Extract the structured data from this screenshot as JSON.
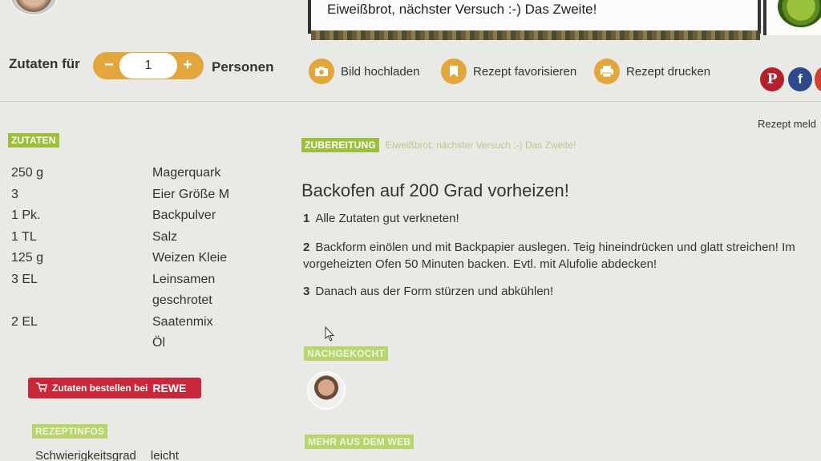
{
  "header": {
    "recipe_title": "Eiweißbrot, nächster Versuch :-) Das Zweite!"
  },
  "servings": {
    "label_before": "Zutaten für",
    "minus": "−",
    "value": "1",
    "plus": "+",
    "label_after": "Personen"
  },
  "actions": {
    "upload": "Bild hochladen",
    "favorite": "Rezept favorisieren",
    "print": "Rezept drucken"
  },
  "social": {
    "pinterest": "P",
    "facebook": "f"
  },
  "report_label": "Rezept meld",
  "ingredients": {
    "tag": "ZUTATEN",
    "items": [
      {
        "amount": "250 g",
        "name": "Magerquark"
      },
      {
        "amount": "3",
        "name": "Eier Größe M"
      },
      {
        "amount": "1 Pk.",
        "name": "Backpulver"
      },
      {
        "amount": "1 TL",
        "name": "Salz"
      },
      {
        "amount": "125 g",
        "name": "Weizen Kleie"
      },
      {
        "amount": "3 EL",
        "name": "Leinsamen"
      },
      {
        "amount": "",
        "name": "geschrotet"
      },
      {
        "amount": "2 EL",
        "name": "Saatenmix"
      },
      {
        "amount": "",
        "name": "Öl"
      }
    ],
    "order_button": "Zutaten bestellen bei",
    "order_brand": "REWE"
  },
  "recipe_info": {
    "tag": "REZEPTINFOS",
    "difficulty_label": "Schwierigkeitsgrad",
    "difficulty_value": "leicht"
  },
  "preparation": {
    "tag": "ZUBEREITUNG",
    "subtitle": "Eiweißbrot, nächster Versuch :-) Das Zweite!",
    "heading": "Backofen auf 200 Grad vorheizen!",
    "steps": [
      {
        "num": "1",
        "text": "Alle Zutaten gut verkneten!"
      },
      {
        "num": "2",
        "text": "Backform einölen und mit Backpapier auslegen. Teig hineindrücken und glatt streichen! Im vorgeheizten Ofen 50 Minuten backen. Evtl. mit Alufolie abdecken!"
      },
      {
        "num": "3",
        "text": "Danach aus der Form stürzen und abkühlen!"
      }
    ]
  },
  "cooked": {
    "tag": "NACHGEKOCHT"
  },
  "more": {
    "tag": "MEHR AUS DEM WEB"
  },
  "colors": {
    "accent_orange": "#e2a63a",
    "tag_green": "#9dbf3b",
    "rewe_red": "#c9283a"
  }
}
